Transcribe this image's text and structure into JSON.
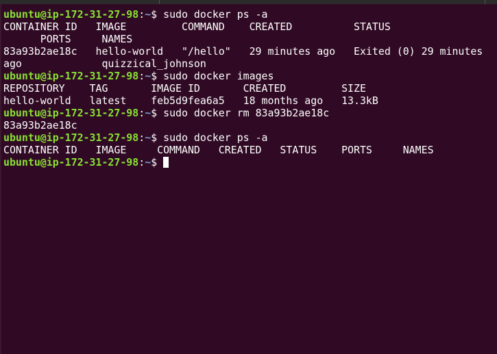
{
  "colors": {
    "background": "#300a24",
    "prompt_user": "#8ae234",
    "prompt_path": "#729fcf",
    "text": "#ffffff"
  },
  "prompt": {
    "user_host": "ubuntu@ip-172-31-27-98",
    "sep": ":",
    "path": "~",
    "symbol": "$ "
  },
  "lines": [
    {
      "type": "prompt",
      "command": "sudo docker ps -a"
    },
    {
      "type": "output",
      "text": "CONTAINER ID   IMAGE         COMMAND    CREATED          STATUS"
    },
    {
      "type": "output",
      "text": "      PORTS     NAMES"
    },
    {
      "type": "output",
      "text": "83a93b2ae18c   hello-world   \"/hello\"   29 minutes ago   Exited (0) 29 minutes"
    },
    {
      "type": "output",
      "text": "ago             quizzical_johnson"
    },
    {
      "type": "prompt",
      "command": "sudo docker images"
    },
    {
      "type": "output",
      "text": "REPOSITORY    TAG       IMAGE ID       CREATED         SIZE"
    },
    {
      "type": "output",
      "text": "hello-world   latest    feb5d9fea6a5   18 months ago   13.3kB"
    },
    {
      "type": "prompt",
      "command": "sudo docker rm 83a93b2ae18c"
    },
    {
      "type": "output",
      "text": "83a93b2ae18c"
    },
    {
      "type": "prompt",
      "command": "sudo docker ps -a"
    },
    {
      "type": "output",
      "text": "CONTAINER ID   IMAGE     COMMAND   CREATED   STATUS    PORTS     NAMES"
    },
    {
      "type": "prompt",
      "command": "",
      "cursor": true
    }
  ]
}
